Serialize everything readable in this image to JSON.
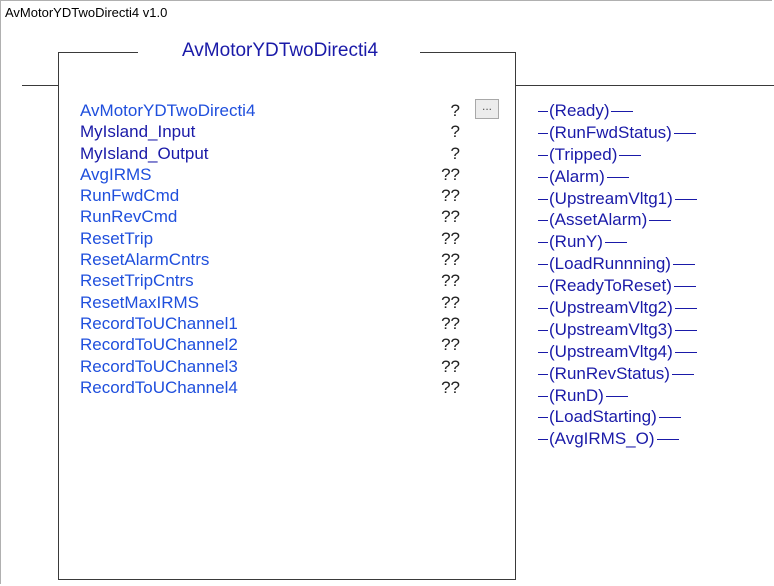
{
  "caption": "AvMotorYDTwoDirecti4 v1.0",
  "block_title": "AvMotorYDTwoDirecti4",
  "browse_label": "...",
  "inputs": [
    {
      "name": "AvMotorYDTwoDirecti4",
      "value": "?"
    },
    {
      "name": "MyIsland_Input",
      "value": "?"
    },
    {
      "name": "MyIsland_Output",
      "value": "?"
    },
    {
      "name": "AvgIRMS",
      "value": "??"
    },
    {
      "name": "RunFwdCmd",
      "value": "??"
    },
    {
      "name": "RunRevCmd",
      "value": "??"
    },
    {
      "name": "ResetTrip",
      "value": "??"
    },
    {
      "name": "ResetAlarmCntrs",
      "value": "??"
    },
    {
      "name": "ResetTripCntrs",
      "value": "??"
    },
    {
      "name": "ResetMaxIRMS",
      "value": "??"
    },
    {
      "name": "RecordToUChannel1",
      "value": "??"
    },
    {
      "name": "RecordToUChannel2",
      "value": "??"
    },
    {
      "name": "RecordToUChannel3",
      "value": "??"
    },
    {
      "name": "RecordToUChannel4",
      "value": "??"
    }
  ],
  "outputs": [
    "Ready",
    "RunFwdStatus",
    "Tripped",
    "Alarm",
    "UpstreamVltg1",
    "AssetAlarm",
    "RunY",
    "LoadRunnning",
    "ReadyToReset",
    "UpstreamVltg2",
    "UpstreamVltg3",
    "UpstreamVltg4",
    "RunRevStatus",
    "RunD",
    "LoadStarting",
    "AvgIRMS_O"
  ]
}
